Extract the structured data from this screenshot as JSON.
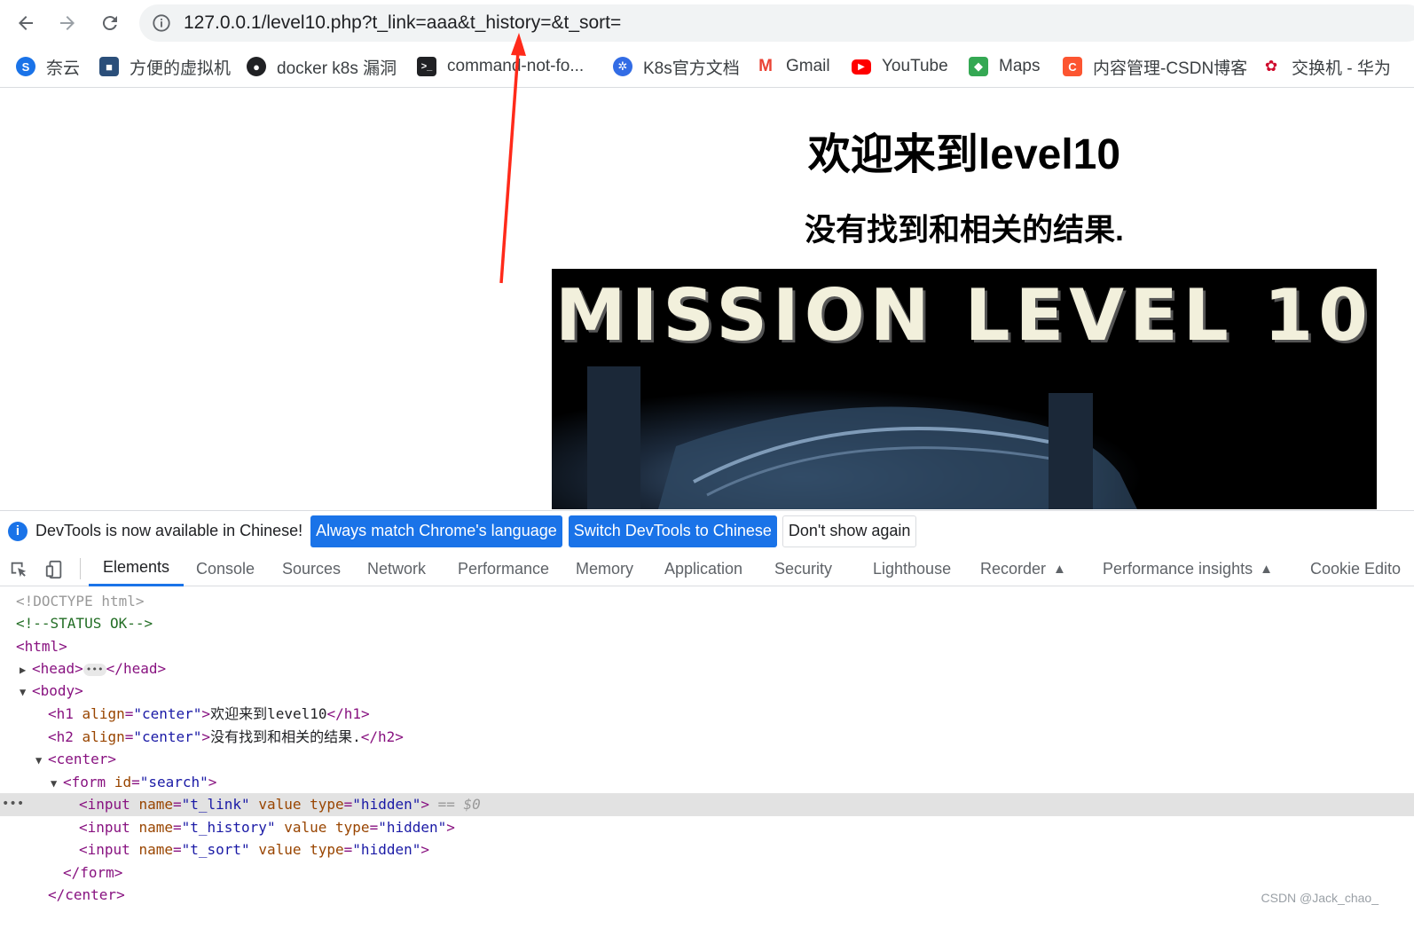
{
  "browser": {
    "url": "127.0.0.1/level10.php?t_link=aaa&t_history=&t_sort=",
    "bookmarks": [
      {
        "label": "奈云",
        "icon": "naiyun-icon",
        "color": "#1a73e8"
      },
      {
        "label": "方便的虚拟机",
        "icon": "box-icon",
        "color": "#2b4f7a"
      },
      {
        "label": "docker k8s 漏洞",
        "icon": "github-icon",
        "color": "#202124"
      },
      {
        "label": "command-not-fo...",
        "icon": "terminal-icon",
        "color": "#202124"
      },
      {
        "label": "K8s官方文档",
        "icon": "kubernetes-icon",
        "color": "#326ce5"
      },
      {
        "label": "Gmail",
        "icon": "gmail-icon",
        "color": "#ea4335"
      },
      {
        "label": "YouTube",
        "icon": "youtube-icon",
        "color": "#ff0000"
      },
      {
        "label": "Maps",
        "icon": "maps-icon",
        "color": "#34a853"
      },
      {
        "label": "内容管理-CSDN博客",
        "icon": "csdn-icon",
        "color": "#fc5531"
      },
      {
        "label": "交换机 - 华为",
        "icon": "huawei-icon",
        "color": "#cf0a2c"
      }
    ]
  },
  "page": {
    "h1": "欢迎来到level10",
    "h2": "没有找到和相关的结果.",
    "banner_text": "MISSION LEVEL 10"
  },
  "devtools": {
    "infobar": {
      "message": "DevTools is now available in Chinese!",
      "always_match": "Always match Chrome's language",
      "switch_chinese": "Switch DevTools to Chinese",
      "dont_show": "Don't show again"
    },
    "tabs": [
      "Elements",
      "Console",
      "Sources",
      "Network",
      "Performance",
      "Memory",
      "Application",
      "Security",
      "Lighthouse",
      "Recorder",
      "Performance insights",
      "Cookie Edito"
    ],
    "dom": {
      "doctype": "<!DOCTYPE html>",
      "comment": "<!--STATUS OK-->",
      "html_open": "<html>",
      "head_open": "<head>",
      "head_close": "</head>",
      "body_open": "<body>",
      "h1_tag": "h1",
      "h1_attr": "align",
      "h1_val": "\"center\"",
      "h1_text": "欢迎来到level10",
      "h2_tag": "h2",
      "h2_attr": "align",
      "h2_val": "\"center\"",
      "h2_text": "没有找到和相关的结果.",
      "center_open": "<center>",
      "form_tag": "form",
      "form_attr": "id",
      "form_val": "\"search\"",
      "inputs": [
        {
          "name": "\"t_link\"",
          "type": "\"hidden\""
        },
        {
          "name": "\"t_history\"",
          "type": "\"hidden\""
        },
        {
          "name": "\"t_sort\"",
          "type": "\"hidden\""
        }
      ],
      "selected_marker": "== $0",
      "form_close": "</form>",
      "center_close": "</center>"
    }
  },
  "watermark": "CSDN @Jack_chao_",
  "colors": {
    "accent": "#1a73e8",
    "arrow": "#ff2a1a"
  }
}
